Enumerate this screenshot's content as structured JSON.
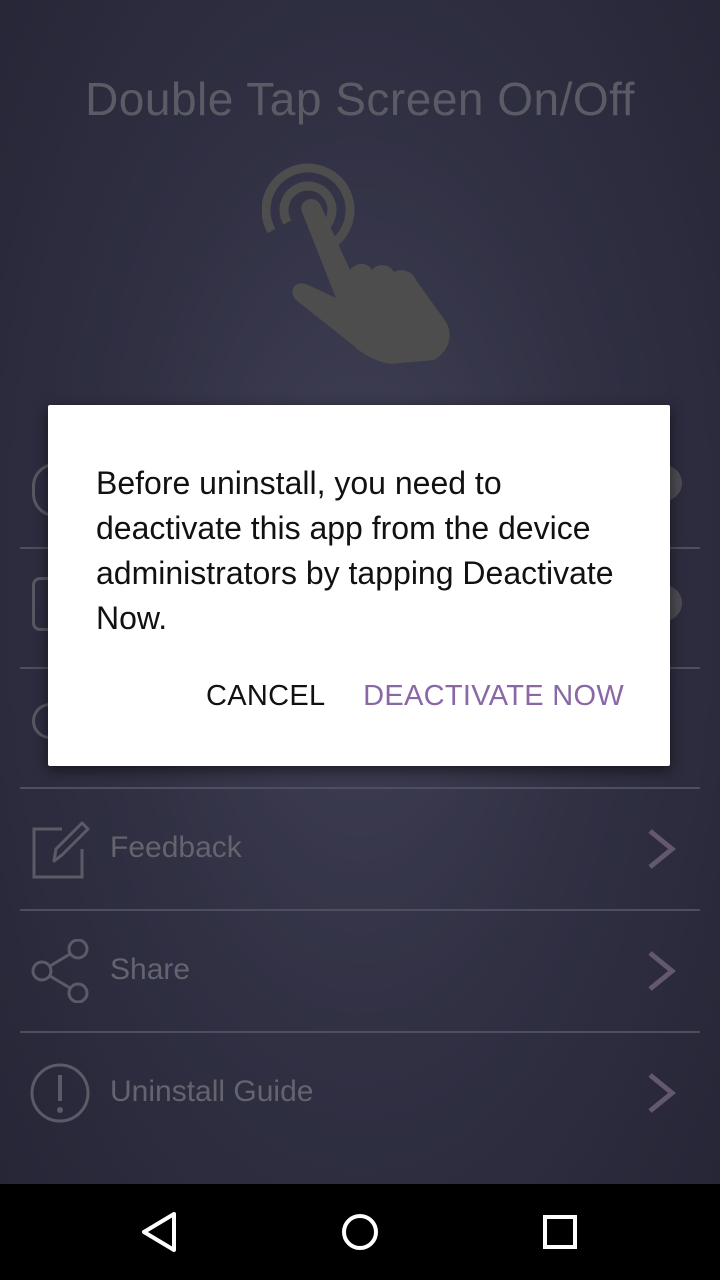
{
  "app": {
    "title": "Double Tap Screen On/Off"
  },
  "list": {
    "items": [
      {
        "label": "Feedback",
        "icon": "edit-icon"
      },
      {
        "label": "Share",
        "icon": "share-icon"
      },
      {
        "label": "Uninstall Guide",
        "icon": "exclamation-icon"
      }
    ]
  },
  "dialog": {
    "message": "Before uninstall, you need to deactivate this app from the device administrators by tapping Deactivate Now.",
    "cancel_label": "CANCEL",
    "confirm_label": "DEACTIVATE NOW"
  },
  "colors": {
    "accent": "#8a68a6",
    "background": "#45445f",
    "navbar": "#000000"
  },
  "navbar": {
    "icons": [
      "back-icon",
      "home-icon",
      "recents-icon"
    ]
  }
}
